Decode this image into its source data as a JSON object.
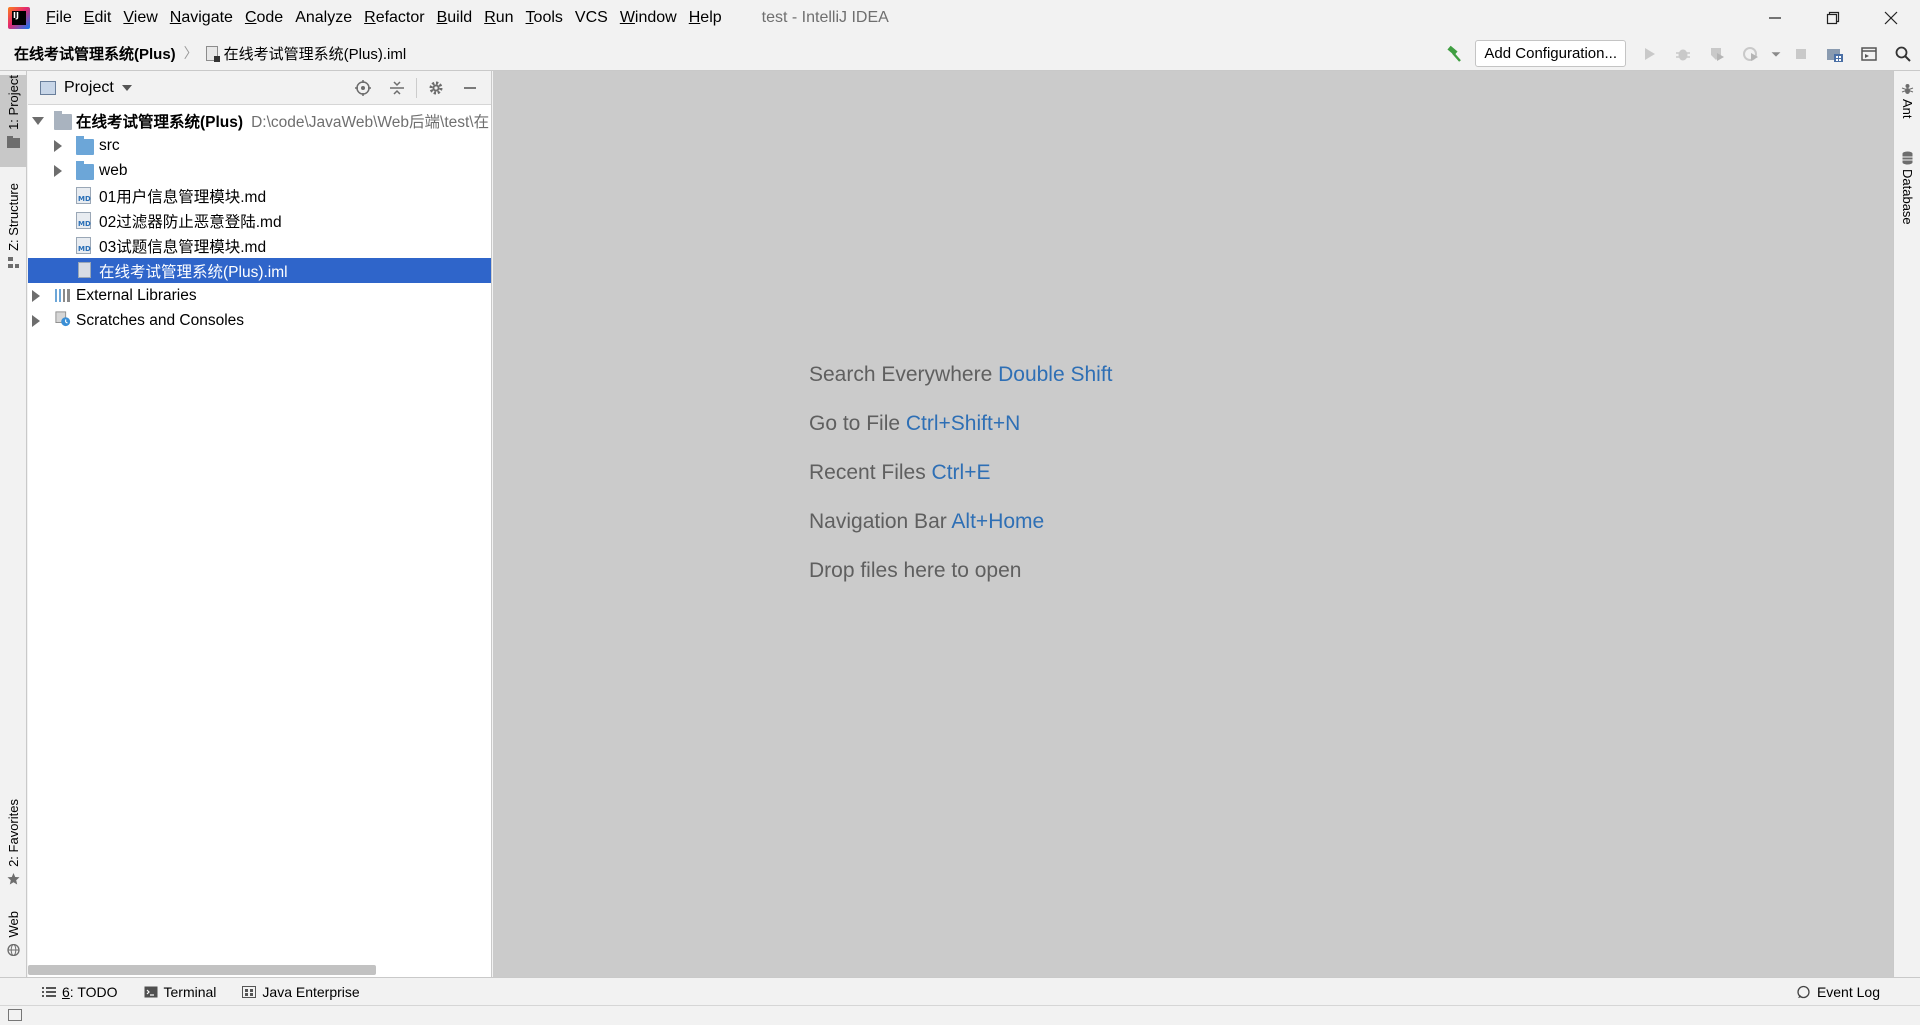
{
  "app": {
    "window_title": "test - IntelliJ IDEA",
    "logo_text": "IJ"
  },
  "menu": [
    {
      "label": "File",
      "mnemonic": "F",
      "rest": "ile"
    },
    {
      "label": "Edit",
      "mnemonic": "E",
      "rest": "dit"
    },
    {
      "label": "View",
      "mnemonic": "V",
      "rest": "iew"
    },
    {
      "label": "Navigate",
      "mnemonic": "N",
      "rest": "avigate"
    },
    {
      "label": "Code",
      "mnemonic": "C",
      "rest": "ode"
    },
    {
      "label": "Analyze",
      "mnemonic": "",
      "rest": "Analyze"
    },
    {
      "label": "Refactor",
      "mnemonic": "R",
      "rest": "efactor"
    },
    {
      "label": "Build",
      "mnemonic": "B",
      "rest": "uild"
    },
    {
      "label": "Run",
      "mnemonic": "R",
      "rest": "un"
    },
    {
      "label": "Tools",
      "mnemonic": "T",
      "rest": "ools"
    },
    {
      "label": "VCS",
      "mnemonic": "",
      "rest": "VCS"
    },
    {
      "label": "Window",
      "mnemonic": "W",
      "rest": "indow"
    },
    {
      "label": "Help",
      "mnemonic": "H",
      "rest": "elp"
    }
  ],
  "breadcrumb": {
    "root": "在线考试管理系统(Plus)",
    "separator": "〉",
    "file": "在线考试管理系统(Plus).iml"
  },
  "toolbar": {
    "add_configuration": "Add Configuration..."
  },
  "left_tabs": {
    "project": "1: Project",
    "structure": "Z: Structure",
    "favorites": "2: Favorites",
    "web": "Web"
  },
  "right_tabs": {
    "ant": "Ant",
    "database": "Database"
  },
  "project_panel": {
    "title": "Project",
    "tree": {
      "root_name": "在线考试管理系统(Plus)",
      "root_path": "D:\\code\\JavaWeb\\Web后端\\test\\在",
      "src": "src",
      "web": "web",
      "md1": "01用户信息管理模块.md",
      "md2": "02过滤器防止恶意登陆.md",
      "md3": "03试题信息管理模块.md",
      "iml": "在线考试管理系统(Plus).iml",
      "external_libraries": "External Libraries",
      "scratches": "Scratches and Consoles"
    }
  },
  "editor_hints": [
    {
      "text": "Search Everywhere ",
      "key": "Double Shift"
    },
    {
      "text": "Go to File ",
      "key": "Ctrl+Shift+N"
    },
    {
      "text": "Recent Files ",
      "key": "Ctrl+E"
    },
    {
      "text": "Navigation Bar ",
      "key": "Alt+Home"
    },
    {
      "text": "Drop files here to open",
      "key": ""
    }
  ],
  "bottom_bar": {
    "todo_mnemonic": "6",
    "todo_rest": ": TODO",
    "terminal": "Terminal",
    "java_enterprise": "Java Enterprise",
    "event_log": "Event Log"
  },
  "colors": {
    "selection": "#2f65ca",
    "editor_background": "#cbcbcb",
    "shortcut_text": "#2e6fb5",
    "build_hammer": "#3f9e41"
  }
}
